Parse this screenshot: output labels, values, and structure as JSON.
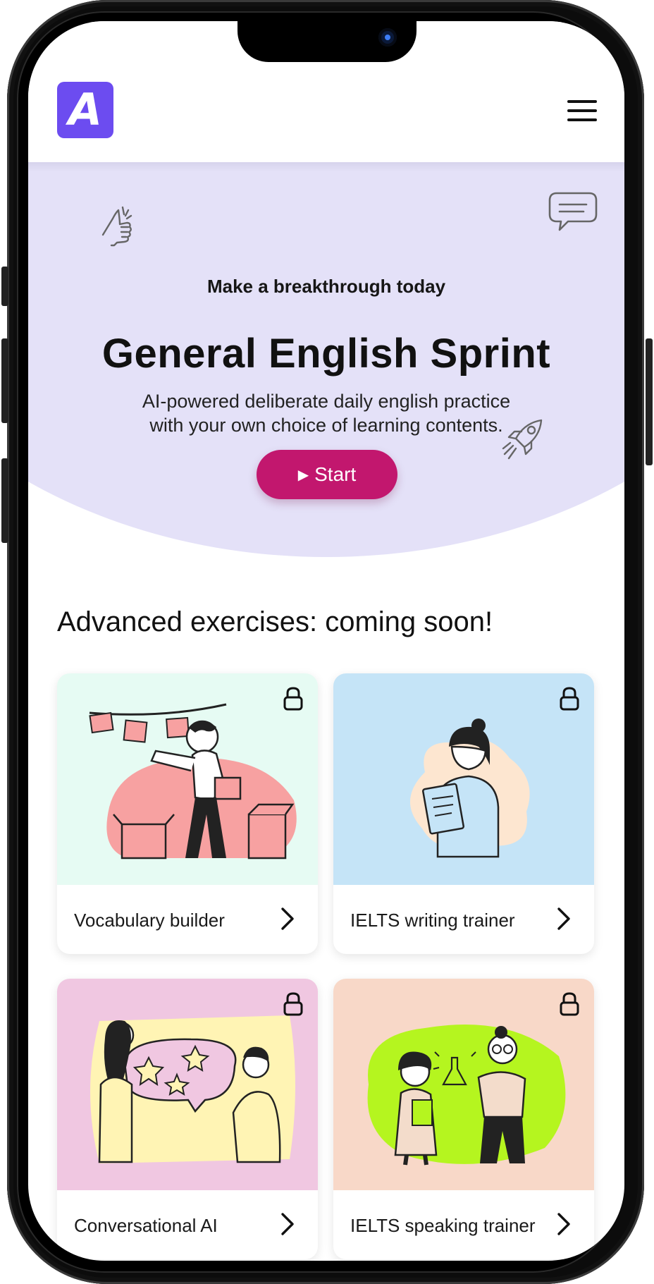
{
  "header": {
    "logo_letter": "A"
  },
  "hero": {
    "eyebrow": "Make a breakthrough today",
    "title": "General English Sprint",
    "description_line1": "AI-powered deliberate daily english practice",
    "description_line2": "with your own choice of learning contents.",
    "start_label": "Start",
    "background_color": "#e4e1f8",
    "button_color": "#c2176e"
  },
  "section": {
    "title": "Advanced exercises: coming soon!"
  },
  "cards": [
    {
      "label": "Vocabulary builder",
      "locked": true,
      "art_color": "#e6fbf3",
      "icon": "vocabulary-illustration"
    },
    {
      "label": "IELTS writing trainer",
      "locked": true,
      "art_color": "#c5e4f7",
      "icon": "writing-illustration"
    },
    {
      "label": "Conversational AI",
      "locked": true,
      "art_color": "#f0c7e1",
      "icon": "conversation-illustration"
    },
    {
      "label": "IELTS speaking trainer",
      "locked": true,
      "art_color": "#f8d8c8",
      "icon": "speaking-illustration"
    }
  ],
  "icons": [
    "menu-icon",
    "thumbs-up-icon",
    "chat-bubble-icon",
    "rocket-icon",
    "play-icon",
    "lock-icon",
    "chevron-right-icon"
  ]
}
